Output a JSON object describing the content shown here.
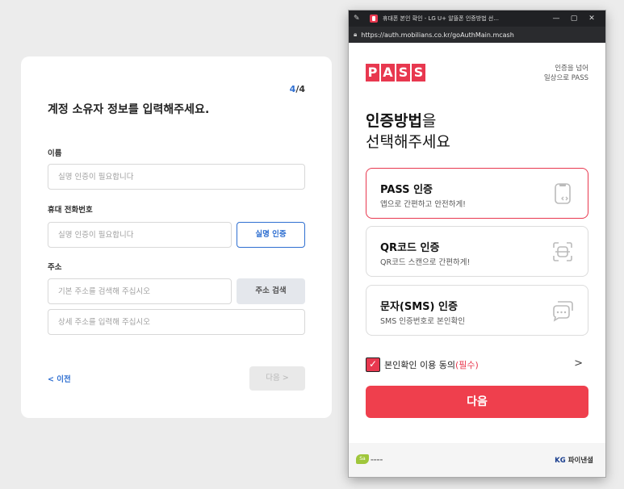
{
  "form": {
    "step_current": "4",
    "step_total": "/4",
    "title": "계정 소유자 정보를 입력해주세요.",
    "name_label": "이름",
    "name_placeholder": "실명 인증이 필요합니다",
    "phone_label": "휴대 전화번호",
    "phone_placeholder": "실명 인증이 필요합니다",
    "verify_button": "실명 인증",
    "address_label": "주소",
    "address_placeholder": "기본 주소를 검색해 주십시오",
    "address_search_button": "주소 검색",
    "address_detail_placeholder": "상세 주소를 입력해 주십시오",
    "prev_link": "< 이전",
    "next_button": "다음 >"
  },
  "popup": {
    "window_title": "휴대폰 본인 확인 - LG U+ 알뜰폰 인증방법 선...",
    "url": "https://auth.mobilians.co.kr/goAuthMain.mcash",
    "logo_letters": [
      "P",
      "A",
      "S",
      "S"
    ],
    "tagline_line1": "인증을 넘어",
    "tagline_line2": "일상으로 PASS",
    "headline_bold": "인증방법",
    "headline_rest": "을",
    "headline_line2": "선택해주세요",
    "options": [
      {
        "title": "PASS 인증",
        "subtitle": "앱으로 간편하고 안전하게!",
        "icon": "phone-icon",
        "selected": true
      },
      {
        "title": "QR코드 인증",
        "subtitle": "QR코드 스캔으로 간편하게!",
        "icon": "qr-scan-icon",
        "selected": false
      },
      {
        "title": "문자(SMS) 인증",
        "subtitle": "SMS 인증번호로 본인확인",
        "icon": "sms-chat-icon",
        "selected": false
      }
    ],
    "agree_text": "본인확인 이용 동의",
    "agree_required": "(필수)",
    "agree_checked": true,
    "next_button": "다음",
    "footer_left": "Sa",
    "footer_right_kg": "KG",
    "footer_right_name": "파이낸셜",
    "accent_color": "#e8384f"
  }
}
